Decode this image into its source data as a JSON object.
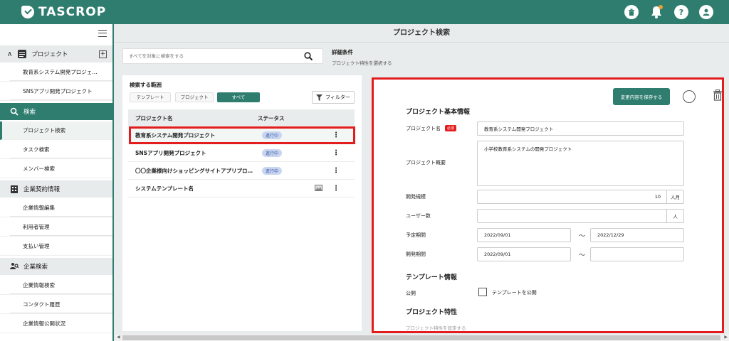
{
  "app": {
    "name": "TASCROP"
  },
  "colors": {
    "brand": "#2e7d6f",
    "highlight": "#e31d1d",
    "required": "#e31d1d",
    "badge_bg": "#c9d6f0"
  },
  "topbar": {
    "icons": [
      "trash-icon",
      "bell-icon",
      "help-icon",
      "user-icon"
    ],
    "help_glyph": "?"
  },
  "sidebar": {
    "groups": [
      {
        "label": "プロジェクト",
        "icon": "project-icon",
        "items": [
          "教育系システム開発プロジェ…",
          "SNSアプリ開発プロジェクト"
        ]
      },
      {
        "label": "検索",
        "icon": "search-icon",
        "items": [
          "プロジェクト検索",
          "タスク検索",
          "メンバー検索"
        ]
      },
      {
        "label": "企業契約情報",
        "icon": "building-icon",
        "items": [
          "企業情報編集",
          "利用者管理",
          "支払い管理"
        ]
      },
      {
        "label": "企業検索",
        "icon": "company-search-icon",
        "items": [
          "企業情報検索",
          "コンタクト履歴",
          "企業情報公開状況"
        ]
      }
    ]
  },
  "main": {
    "title": "プロジェクト検索",
    "search": {
      "placeholder": "すべてを対象に検索をする"
    },
    "detail_conditions": {
      "title": "詳細条件",
      "subtitle": "プロジェクト特性を選択する"
    }
  },
  "list": {
    "scope_label": "検索する範囲",
    "scope_options": [
      "テンプレート",
      "プロジェクト",
      "すべて"
    ],
    "selected_scope": "すべて",
    "filter_label": "フィルター",
    "columns": [
      "プロジェクト名",
      "ステータス"
    ],
    "rows": [
      {
        "name": "教育系システム開発プロジェクト",
        "status": "進行中"
      },
      {
        "name": "SNSアプリ開発プロジェクト",
        "status": "進行中"
      },
      {
        "name": "〇〇企業様向けショッピングサイトアプリプロ…",
        "status": "進行中"
      },
      {
        "name": "システムテンプレート名",
        "status": ""
      }
    ]
  },
  "form": {
    "save_label": "変更内容を保存する",
    "section_basic": "プロジェクト基本情報",
    "name_label": "プロジェクト名",
    "required_badge": "必須",
    "name_value": "教育系システム開発プロジェクト",
    "summary_label": "プロジェクト概要",
    "summary_value": "小学校教育系システムの開発プロジェクト",
    "scale_label": "開発規模",
    "scale_value": "10",
    "scale_unit": "人月",
    "members_label": "ユーザー数",
    "members_value": "",
    "members_unit": "人",
    "planned_label": "予定期間",
    "planned_start": "2022/09/01",
    "planned_end": "2022/12/29",
    "dev_label": "開発期間",
    "dev_start": "2022/09/01",
    "dev_end": "",
    "range_sep": "〜",
    "section_template": "テンプレート情報",
    "public_label": "公開",
    "public_checkbox_label": "テンプレートを公開",
    "section_traits": "プロジェクト特性",
    "traits_hint": "プロジェクト特性を設定する"
  }
}
